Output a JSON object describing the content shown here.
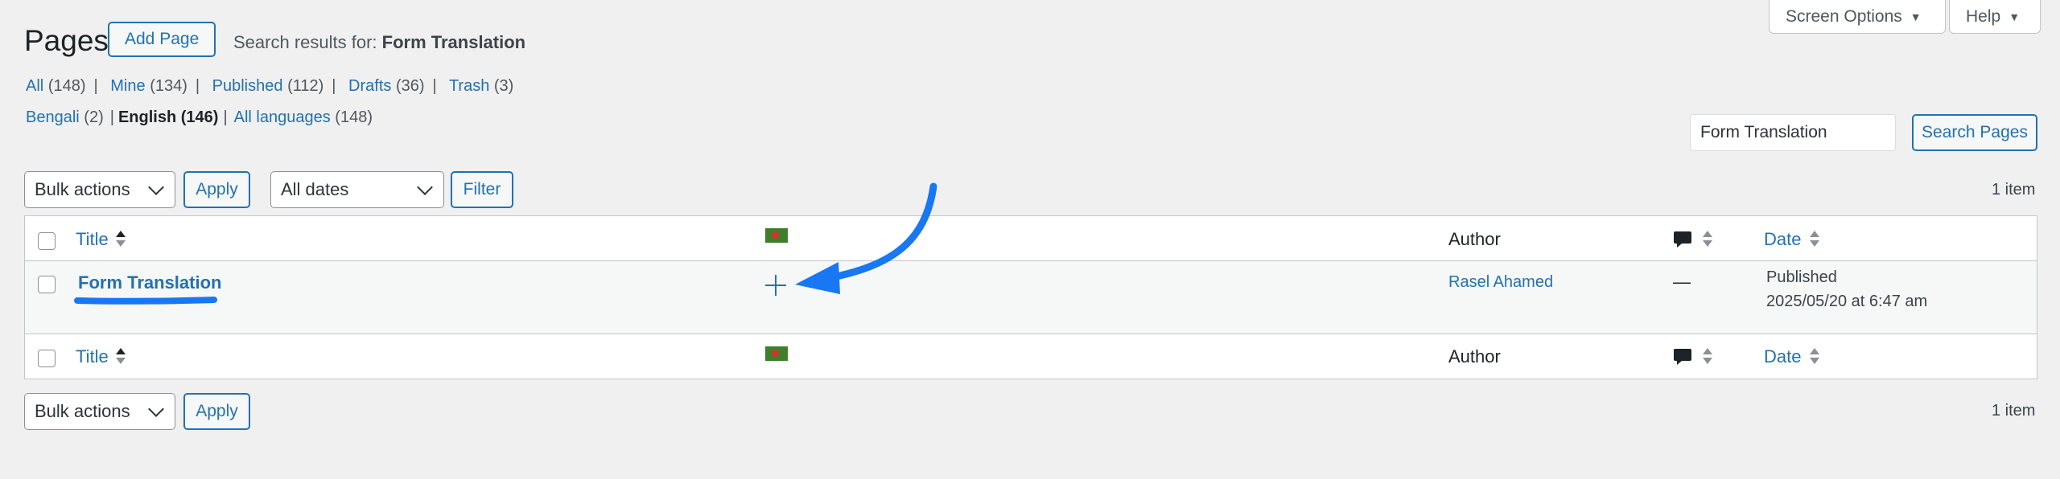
{
  "header": {
    "title": "Pages",
    "add_button": "Add Page",
    "search_prefix": "Search results for: ",
    "search_term": "Form Translation",
    "screen_options": "Screen Options",
    "help": "Help"
  },
  "views": [
    {
      "label": "All",
      "count": "(148)"
    },
    {
      "label": "Mine",
      "count": "(134)"
    },
    {
      "label": "Published",
      "count": "(112)"
    },
    {
      "label": "Drafts",
      "count": "(36)"
    },
    {
      "label": "Trash",
      "count": "(3)"
    }
  ],
  "languages": [
    {
      "label": "Bengali",
      "count": "(2)",
      "current": false
    },
    {
      "label": "English",
      "count": "(146)",
      "current": true
    },
    {
      "label": "All languages",
      "count": "(148)",
      "current": false
    }
  ],
  "search": {
    "value": "Form Translation",
    "button": "Search Pages"
  },
  "tablenav_top": {
    "bulk": "Bulk actions",
    "apply": "Apply",
    "dates": "All dates",
    "filter": "Filter",
    "count": "1 item"
  },
  "tablenav_bottom": {
    "bulk": "Bulk actions",
    "apply": "Apply",
    "count": "1 item"
  },
  "table": {
    "columns": {
      "title": "Title",
      "author": "Author",
      "date": "Date"
    },
    "rows": [
      {
        "title": "Form Translation",
        "author": "Rasel Ahamed",
        "comments": "—",
        "status": "Published",
        "date": "2025/05/20 at 6:47 am"
      }
    ]
  },
  "icons": {
    "language_flag": "bangladesh-flag-icon",
    "add_translation": "plus-icon",
    "comments": "comment-bubble-icon"
  },
  "colors": {
    "link": "#2271b1",
    "annotation": "#1877f2",
    "background": "#f0f0f1"
  }
}
